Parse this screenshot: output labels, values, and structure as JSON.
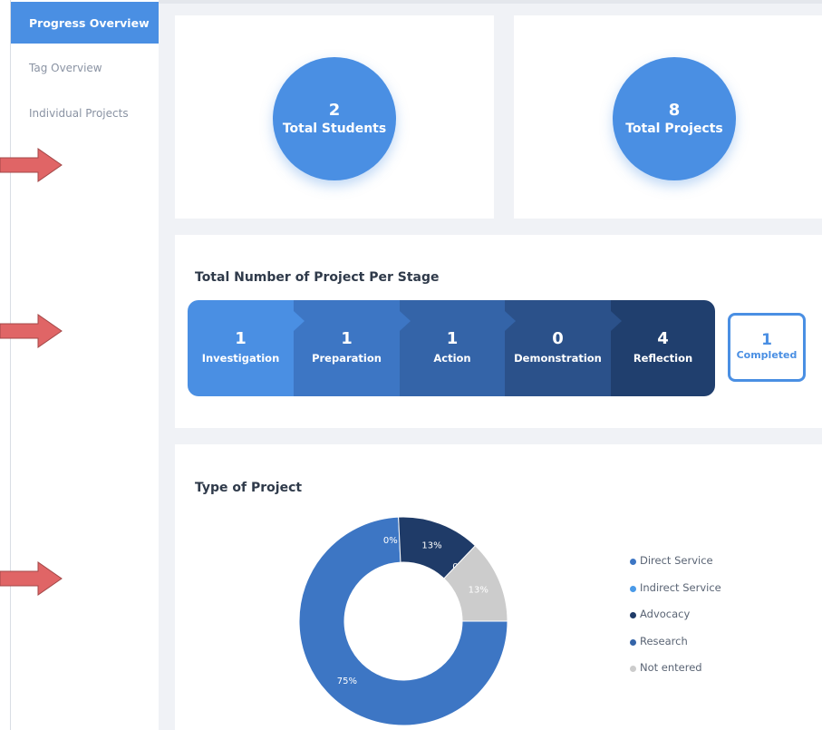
{
  "sidebar": {
    "items": [
      {
        "label": "Progress Overview",
        "active": true
      },
      {
        "label": "Tag Overview",
        "active": false
      },
      {
        "label": "Individual Projects",
        "active": false
      }
    ]
  },
  "arrow_color": "#e06566",
  "summary": {
    "students": {
      "value": "2",
      "label": "Total Students"
    },
    "projects": {
      "value": "8",
      "label": "Total Projects"
    }
  },
  "stages": {
    "title": "Total Number of Project Per Stage",
    "items": [
      {
        "value": "1",
        "label": "Investigation",
        "color": "#4a8fe3"
      },
      {
        "value": "1",
        "label": "Preparation",
        "color": "#3d76c4"
      },
      {
        "value": "1",
        "label": "Action",
        "color": "#3464a8"
      },
      {
        "value": "0",
        "label": "Demonstration",
        "color": "#2b518a"
      },
      {
        "value": "4",
        "label": "Reflection",
        "color": "#203f6e"
      }
    ],
    "completed": {
      "value": "1",
      "label": "Completed"
    }
  },
  "project_types": {
    "title": "Type of Project",
    "chart_data": {
      "type": "pie",
      "categories": [
        "Direct Service",
        "Indirect Service",
        "Advocacy",
        "Research",
        "Not entered"
      ],
      "values": [
        75,
        0,
        13,
        0,
        13
      ],
      "labels": [
        "75%",
        "0%",
        "13%",
        "0%",
        "13%"
      ],
      "colors": [
        "#3d76c4",
        "#4a9ae8",
        "#1f3b68",
        "#3464a8",
        "#cccccc"
      ],
      "legend_position": "right"
    }
  }
}
